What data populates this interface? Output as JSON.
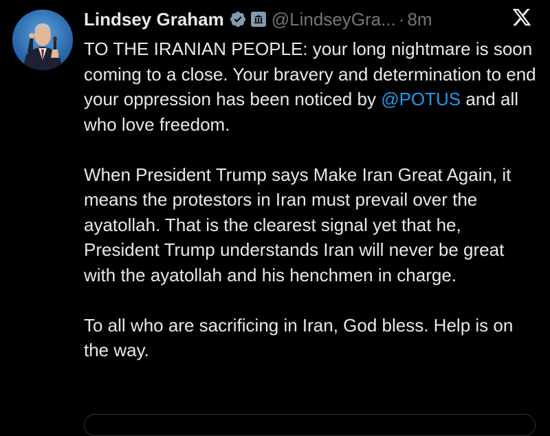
{
  "author": {
    "name": "Lindsey Graham",
    "handle": "@LindseyGra...",
    "separator": "·",
    "time": "8m"
  },
  "tweet": {
    "p1_before": "TO THE IRANIAN PEOPLE: your long nightmare is soon coming to a close. Your bravery and determination to end your oppression has been noticed by ",
    "p1_mention": "@POTUS",
    "p1_after": " and all who love freedom.",
    "p2": "When President Trump says Make Iran Great Again, it means the protestors in Iran must prevail over the ayatollah. That is the clearest signal yet that he, President Trump understands Iran will never be great with the ayatollah and his henchmen in charge.",
    "p3": "To all who are sacrificing in Iran, God bless. Help is on the way."
  },
  "icons": {
    "verified": "verified-check-icon",
    "government": "government-badge-icon",
    "platform": "x-logo-icon"
  },
  "colors": {
    "background": "#000000",
    "text": "#e7e9ea",
    "muted": "#71767b",
    "link": "#1d9bf0",
    "gov_badge": "#829aab"
  }
}
